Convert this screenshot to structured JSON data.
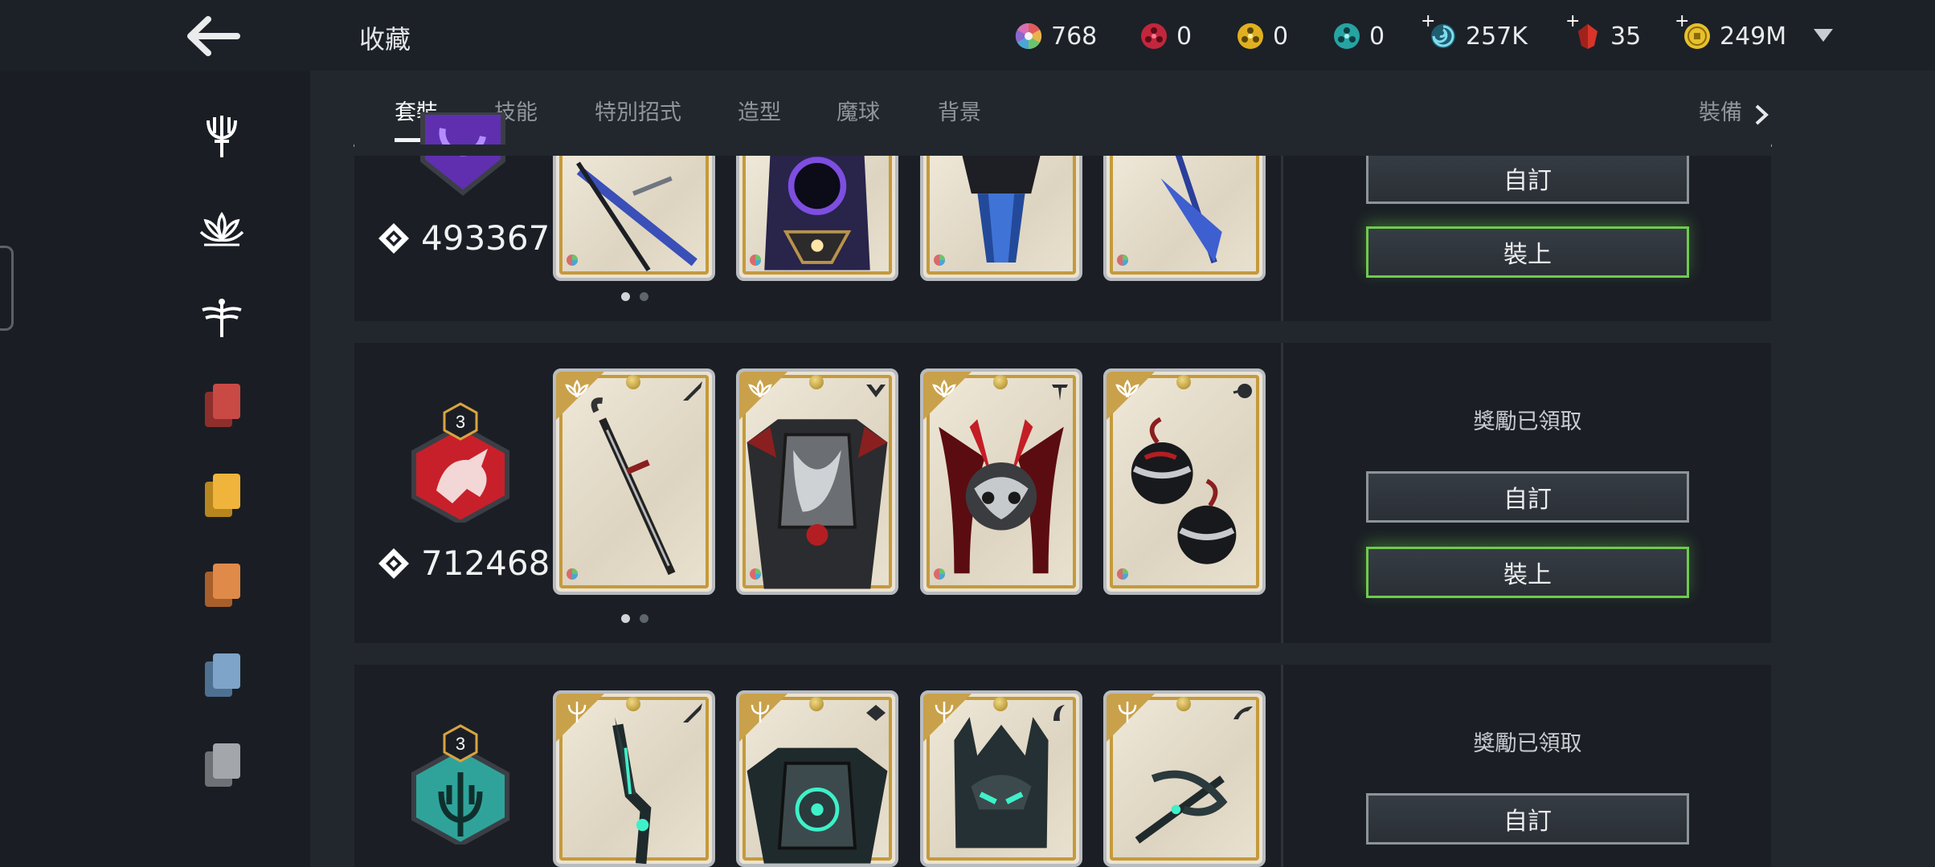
{
  "header": {
    "title": "收藏",
    "resources": [
      {
        "name": "rainbow-orb",
        "value": "768",
        "plus": false,
        "color": "#d96b6b"
      },
      {
        "name": "red-orb",
        "value": "0",
        "plus": false,
        "color": "#c3263c"
      },
      {
        "name": "gold-orb",
        "value": "0",
        "plus": false,
        "color": "#e0b020"
      },
      {
        "name": "teal-orb",
        "value": "0",
        "plus": false,
        "color": "#27a3a3"
      },
      {
        "name": "swirl-energy",
        "value": "257K",
        "plus": true,
        "color": "#5cc6e0"
      },
      {
        "name": "ruby",
        "value": "35",
        "plus": true,
        "color": "#d8342a"
      },
      {
        "name": "coin",
        "value": "249M",
        "plus": true,
        "color": "#e7c02d"
      }
    ]
  },
  "tabs": [
    {
      "label": "套裝",
      "active": true
    },
    {
      "label": "技能",
      "active": false
    },
    {
      "label": "特別招式",
      "active": false
    },
    {
      "label": "造型",
      "active": false
    },
    {
      "label": "魔球",
      "active": false
    },
    {
      "label": "背景",
      "active": false
    },
    {
      "label": "裝備",
      "active": false
    }
  ],
  "sidebar": {
    "items": [
      {
        "icon": "trident-icon",
        "color": "#ffffff"
      },
      {
        "icon": "lotus-icon",
        "color": "#ffffff"
      },
      {
        "icon": "dragonfly-icon",
        "color": "#ffffff"
      },
      {
        "icon": "red-cards-icon",
        "color": "#c94a45"
      },
      {
        "icon": "yellow-cards-icon",
        "color": "#f0b43c"
      },
      {
        "icon": "orange-cards-icon",
        "color": "#e08a4a"
      },
      {
        "icon": "blue-cards-icon",
        "color": "#7ea4c9"
      },
      {
        "icon": "gray-cards-icon",
        "color": "#a3a6aa"
      }
    ]
  },
  "sets": [
    {
      "id": "purple-set",
      "emblem_color": "#7a3fd0",
      "score": "493367",
      "cards": [
        "weapon",
        "armor",
        "helmet",
        "ranged"
      ],
      "customize_label": "自訂",
      "equip_label": "裝上"
    },
    {
      "id": "red-set",
      "emblem_color": "#c8202a",
      "level": "3",
      "score": "712468",
      "cards": [
        "weapon",
        "armor",
        "helmet",
        "ranged"
      ],
      "reward_text": "獎勵已領取",
      "customize_label": "自訂",
      "equip_label": "裝上"
    },
    {
      "id": "teal-set",
      "emblem_color": "#2fa39a",
      "level": "3",
      "cards": [
        "weapon",
        "armor",
        "helmet",
        "ranged"
      ],
      "reward_text": "獎勵已領取",
      "customize_label": "自訂"
    }
  ]
}
